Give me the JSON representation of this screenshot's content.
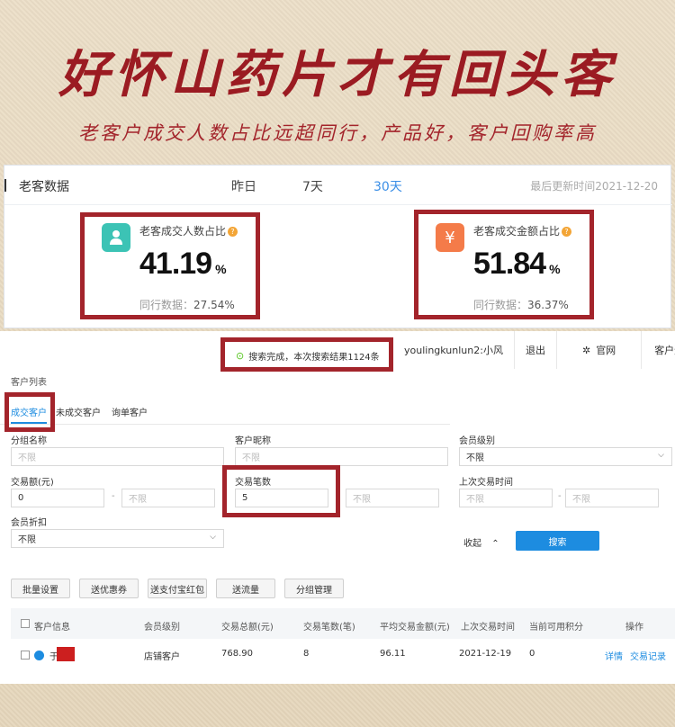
{
  "banner": {
    "title": "好怀山药片才有回头客",
    "subtitle": "老客户成交人数占比远超同行，产品好，客户回购率高"
  },
  "panel": {
    "title": "老客数据",
    "tabs": [
      "昨日",
      "7天",
      "30天"
    ],
    "active_tab": "30天",
    "updated": "最后更新时间2021-12-20",
    "metrics": [
      {
        "label": "老客成交人数占比",
        "value": "41.19",
        "unit": "%",
        "peer_label": "同行数据：",
        "peer_value": "27.54%",
        "icon": "user-icon",
        "icon_color": "#3cc3b5"
      },
      {
        "label": "老客成交金额占比",
        "value": "51.84",
        "unit": "%",
        "peer_label": "同行数据：",
        "peer_value": "36.37%",
        "icon": "yen-icon",
        "icon_color": "#f47b49"
      }
    ]
  },
  "toast": {
    "text": "搜索完成，本次搜索结果1124条"
  },
  "topnav": {
    "user": "youlingkunlun2:小风",
    "logout": "退出",
    "site": "官网",
    "ops": "客户运营"
  },
  "section_label": "客户列表",
  "subtabs": [
    "成交客户",
    "未成交客户",
    "询单客户"
  ],
  "filters": {
    "group_name": {
      "label": "分组名称",
      "placeholder": "不限"
    },
    "nickname": {
      "label": "客户昵称",
      "placeholder": "不限"
    },
    "level": {
      "label": "会员级别",
      "value": "不限"
    },
    "amount": {
      "label": "交易额(元)",
      "min": "0",
      "dash": "-",
      "max_placeholder": "不限"
    },
    "count": {
      "label": "交易笔数",
      "min": "5",
      "max_placeholder": "不限"
    },
    "last_time": {
      "label": "上次交易时间",
      "start_placeholder": "不限",
      "dash": "-",
      "end_placeholder": "不限"
    },
    "discount": {
      "label": "会员折扣",
      "value": "不限"
    }
  },
  "collapse_label": "收起",
  "search_label": "搜索",
  "actions": [
    "批量设置",
    "送优惠券",
    "送支付宝红包",
    "送流量",
    "分组管理"
  ],
  "table": {
    "headers": [
      "客户信息",
      "会员级别",
      "交易总额(元)",
      "交易笔数(笔)",
      "平均交易金额(元)",
      "上次交易时间",
      "当前可用积分",
      "操作"
    ],
    "row": {
      "name": "于",
      "level": "店铺客户",
      "total": "768.90",
      "count": "8",
      "avg": "96.11",
      "last": "2021-12-19",
      "points": "0",
      "op_detail": "详情",
      "op_records": "交易记录"
    }
  },
  "colors": {
    "accent": "#a3242b",
    "link": "#1d8ce0",
    "active_tab": "#3a8ee6"
  }
}
